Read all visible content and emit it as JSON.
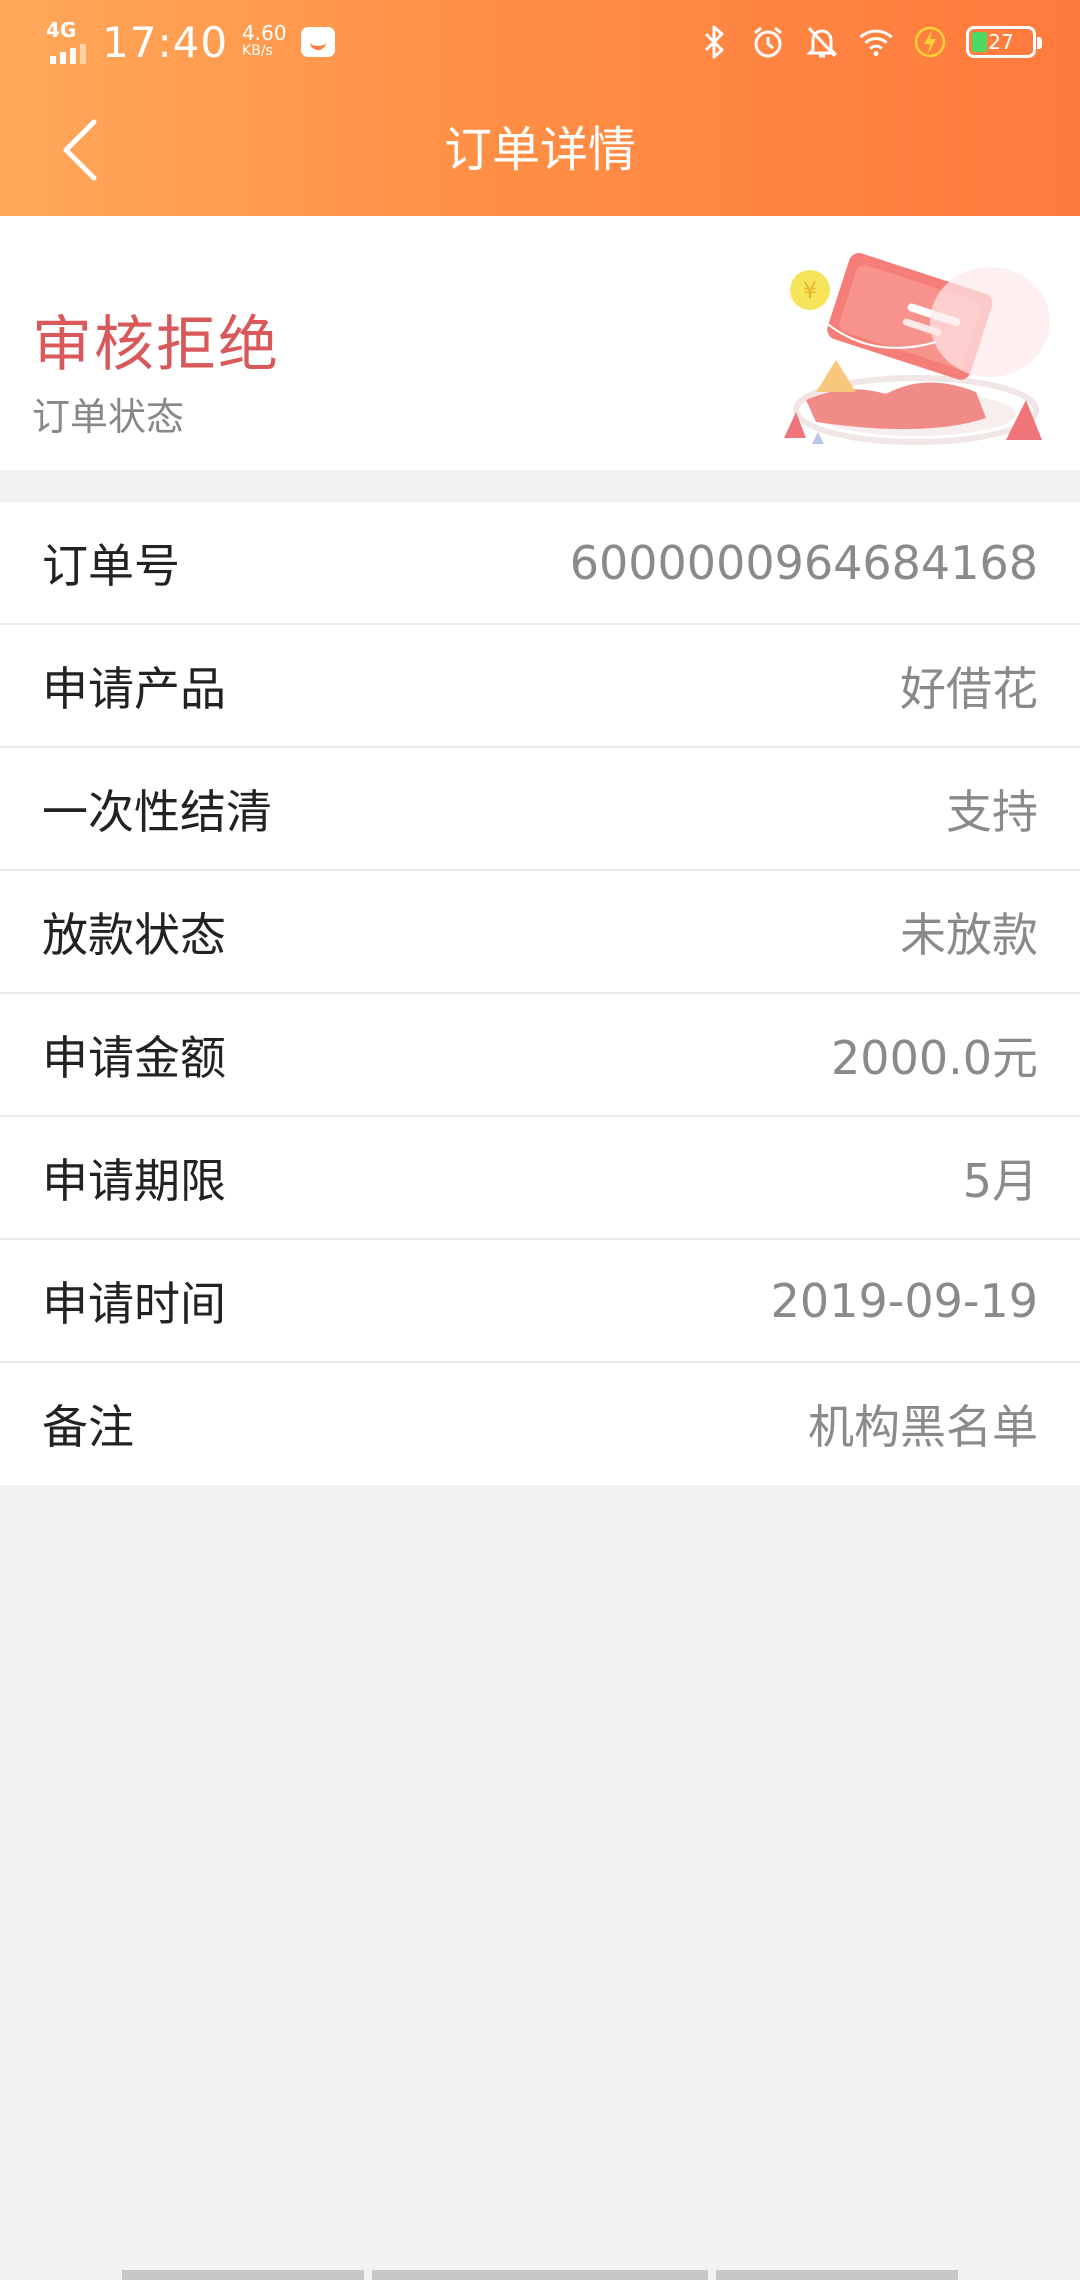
{
  "status_bar": {
    "network": "4G",
    "time": "17:40",
    "speed_value": "4.60",
    "speed_unit": "KB/s",
    "battery": "27",
    "icons": [
      "app-icon",
      "bluetooth-icon",
      "alarm-icon",
      "mute-icon",
      "wifi-icon",
      "charging-icon",
      "battery-icon"
    ]
  },
  "header": {
    "title": "订单详情"
  },
  "order_status": {
    "value": "审核拒绝",
    "label": "订单状态"
  },
  "details": [
    {
      "key": "订单号",
      "value": "6000000964684168"
    },
    {
      "key": "申请产品",
      "value": "好借花"
    },
    {
      "key": "一次性结清",
      "value": "支持"
    },
    {
      "key": "放款状态",
      "value": "未放款"
    },
    {
      "key": "申请金额",
      "value": "2000.0元"
    },
    {
      "key": "申请期限",
      "value": "5月"
    },
    {
      "key": "申请时间",
      "value": "2019-09-19"
    },
    {
      "key": "备注",
      "value": "机构黑名单"
    }
  ],
  "colors": {
    "header_start": "#ffa85a",
    "header_end": "#ff7a3d",
    "status_text": "#d9585a",
    "value_text": "#8a8a8a",
    "background": "#f2f2f2"
  }
}
